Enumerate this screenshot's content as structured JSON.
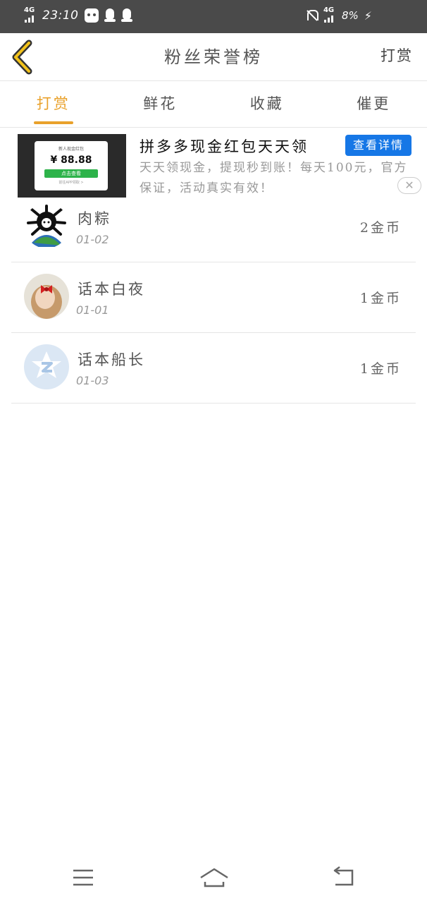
{
  "status_bar": {
    "network_left": "4G",
    "time": "23:10",
    "network_right": "4G",
    "battery": "8%",
    "icons": [
      "signal-icon",
      "app-icon",
      "qq-icon",
      "qq-icon",
      "mute-bell-icon",
      "charging-icon"
    ]
  },
  "header": {
    "title": "粉丝荣誉榜",
    "right_action": "打赏"
  },
  "tabs": [
    {
      "label": "打赏",
      "active": true
    },
    {
      "label": "鲜花",
      "active": false
    },
    {
      "label": "收藏",
      "active": false
    },
    {
      "label": "催更",
      "active": false
    }
  ],
  "ad": {
    "title": "拼多多现金红包天天领",
    "cta": "查看详情",
    "description": "天天领现金，提现秒到账！每天100元，官方保证，活动真实有效！",
    "image": {
      "card_title": "新人现金红包",
      "amount": "¥ 88.88",
      "button": "点击查看",
      "footer": "前往APP领取 >"
    },
    "close_label": "✕"
  },
  "rows": [
    {
      "name": "肉粽",
      "date": "01-02",
      "amount": "2金币"
    },
    {
      "name": "话本白夜",
      "date": "01-01",
      "amount": "1金币"
    },
    {
      "name": "话本船长",
      "date": "01-03",
      "amount": "1金币"
    }
  ],
  "colors": {
    "accent": "#e9a12b",
    "cta_blue": "#1677e6",
    "status_bar": "#4a4a4a"
  }
}
